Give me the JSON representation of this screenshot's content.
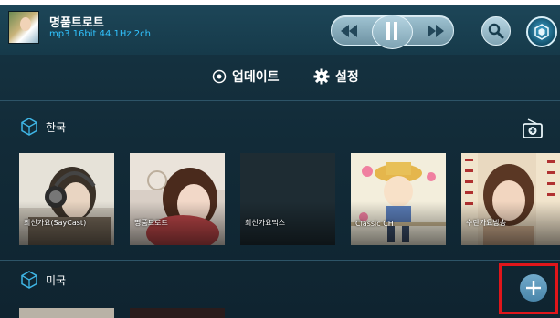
{
  "now_playing": {
    "title": "명품트로트",
    "info": "mp3  16bit  44.1Hz  2ch",
    "controls": {
      "prev_icon": "rewind-icon",
      "pause_icon": "pause-icon",
      "next_icon": "fast-forward-icon"
    },
    "search_icon": "search-icon",
    "settings_icon": "gear-icon"
  },
  "menu": {
    "update_label": "업데이트",
    "settings_label": "설정"
  },
  "sections": [
    {
      "title": "한국",
      "stations": [
        {
          "label": "최신가요(SayCast)"
        },
        {
          "label": "명품트로트"
        },
        {
          "label": "최신가요믹스"
        },
        {
          "label": "Classic CH"
        },
        {
          "label": "수란가요방송"
        }
      ]
    },
    {
      "title": "미국"
    }
  ],
  "colors": {
    "accent": "#31c3ff",
    "background": "#122b38",
    "highlight_box": "#e0161b"
  }
}
